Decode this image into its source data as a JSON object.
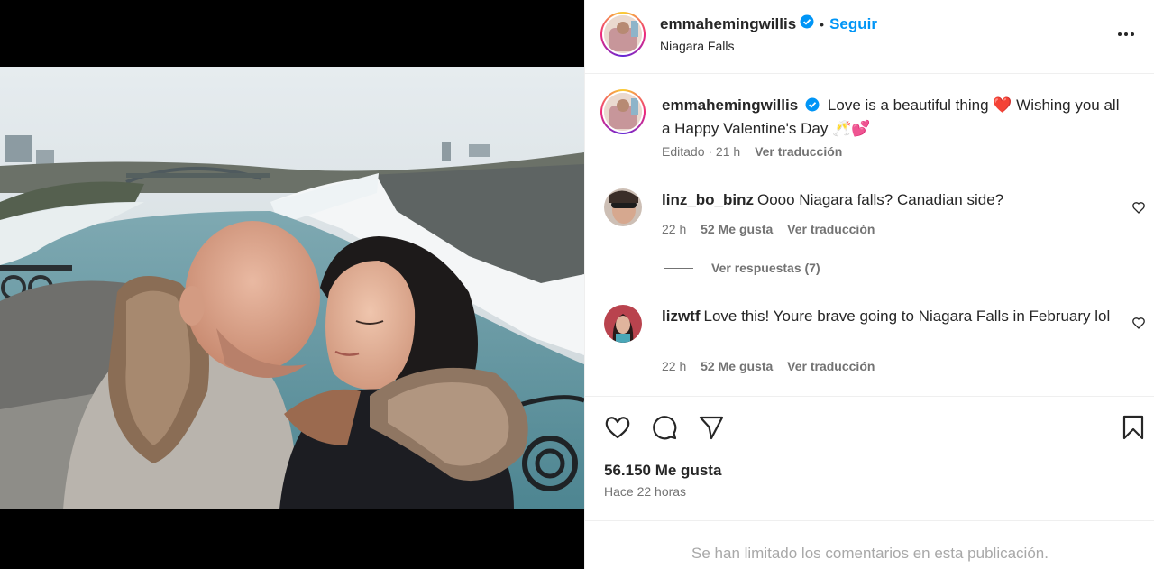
{
  "post": {
    "author": "emmahemingwillis",
    "follow_label": "Seguir",
    "separator": "•",
    "location": "Niagara Falls"
  },
  "caption": {
    "username": "emmahemingwillis",
    "text": "Love is a beautiful thing ❤️ Wishing you all a Happy Valentine's Day 🥂💕",
    "edited": "Editado · 21 h",
    "translate": "Ver traducción"
  },
  "comments": [
    {
      "username": "linz_bo_binz",
      "text": "Oooo Niagara falls? Canadian side?",
      "time": "22 h",
      "likes": "52 Me gusta",
      "translate": "Ver traducción"
    },
    {
      "username": "lizwtf",
      "text": "Love this! Youre brave going to Niagara Falls in February lol",
      "time": "22 h",
      "likes": "52 Me gusta",
      "translate": "Ver traducción"
    }
  ],
  "replies_label": "Ver respuestas (7)",
  "stats": {
    "likes": "56.150 Me gusta",
    "time": "Hace 22 horas"
  },
  "footer": {
    "limited": "Se han limitado los comentarios en esta publicación."
  },
  "icons": [
    "verified-badge-icon",
    "more-options-icon",
    "heart-icon",
    "comment-icon",
    "share-icon",
    "bookmark-icon"
  ],
  "colors": {
    "accent": "#0095f6",
    "text": "#262626",
    "secondary": "#737373",
    "muted": "#a8a8a8",
    "heart": "#e0245e"
  }
}
